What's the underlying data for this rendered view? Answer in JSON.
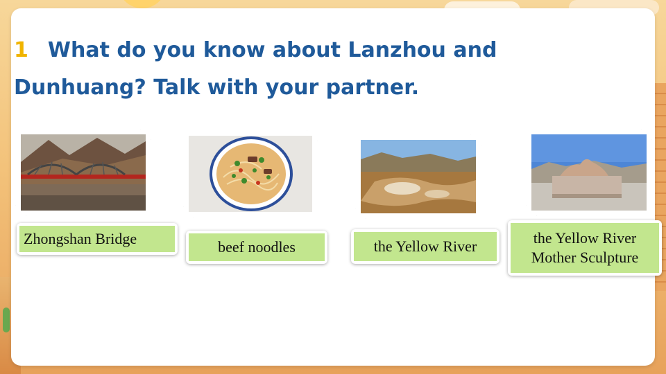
{
  "slide": {
    "number": "1",
    "title_line1": "What do you know about Lanzhou and",
    "title_line2": "Dunhuang?   Talk with your partner."
  },
  "items": [
    {
      "label": "Zhongshan Bridge",
      "image": "iron bridge over river with hills"
    },
    {
      "label": "beef noodles",
      "image": "bowl of beef noodles"
    },
    {
      "label": "the Yellow River",
      "image": "yellow river waterfall"
    },
    {
      "label_line1": "the Yellow River",
      "label_line2": "Mother Sculpture",
      "image": "yellow river mother statue"
    }
  ],
  "colors": {
    "title": "#1f5a9a",
    "number": "#f0b400",
    "label_bg": "#c2e68e"
  }
}
